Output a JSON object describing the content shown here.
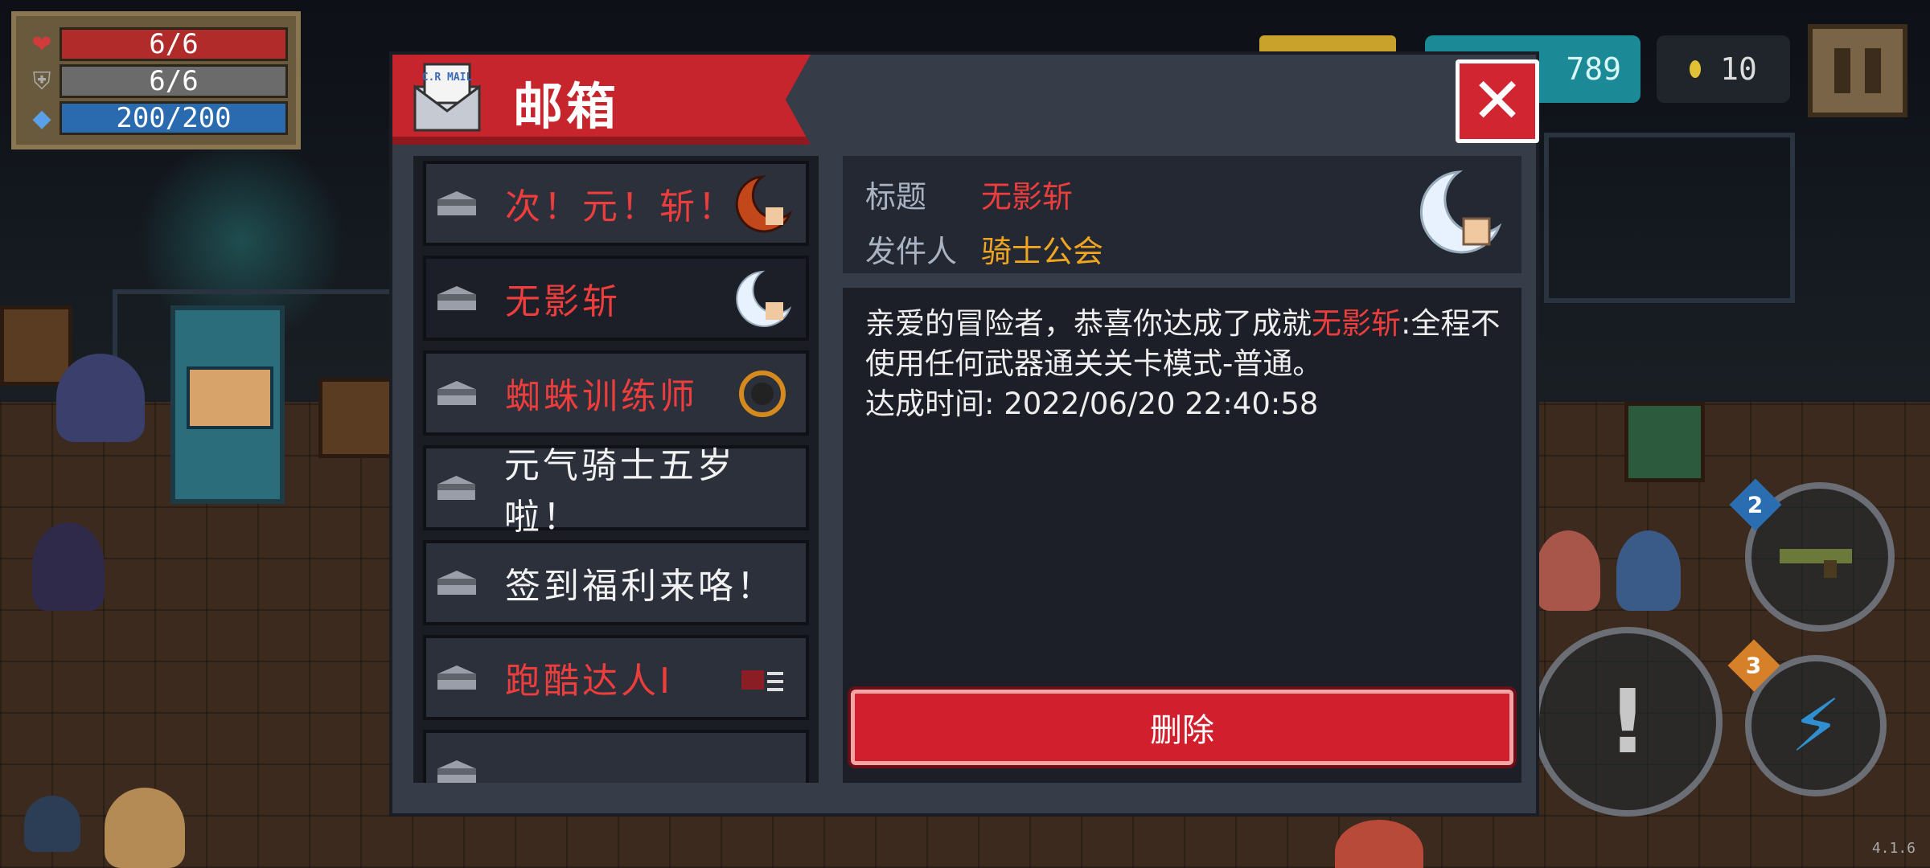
{
  "hud": {
    "health": "6/6",
    "armor": "6/6",
    "energy": "200/200",
    "gems": "789",
    "coins": "10",
    "version": "4.1.6",
    "skill_badge_1": "2",
    "skill_badge_2": "3"
  },
  "mailbox": {
    "title": "邮箱",
    "mail_icon_text": "C.R MAIL",
    "items": [
      {
        "label": "次！元！斩！",
        "color": "#ee3d3d"
      },
      {
        "label": "无影斩",
        "color": "#ee3d3d"
      },
      {
        "label": "蜘蛛训练师",
        "color": "#ee3d3d"
      },
      {
        "label": "元气骑士五岁啦！",
        "color": "#f2f2f2"
      },
      {
        "label": "签到福利来咯！",
        "color": "#f2f2f2"
      },
      {
        "label": "跑酷达人I",
        "color": "#ee3d3d"
      }
    ],
    "detail": {
      "title_label": "标题",
      "title_value": "无影斩",
      "sender_label": "发件人",
      "sender_value": "骑士公会",
      "message_prefix": "亲爱的冒险者，恭喜你达成了成就",
      "message_highlight": "无影斩",
      "message_suffix": ":全程不使用任何武器通关关卡模式-普通。",
      "achieved_line": "达成时间: 2022/06/20 22:40:58",
      "delete_label": "删除"
    }
  },
  "colors": {
    "accent_red": "#c6252d",
    "highlight_red": "#ee3d3d",
    "sender_orange": "#f0a520"
  }
}
